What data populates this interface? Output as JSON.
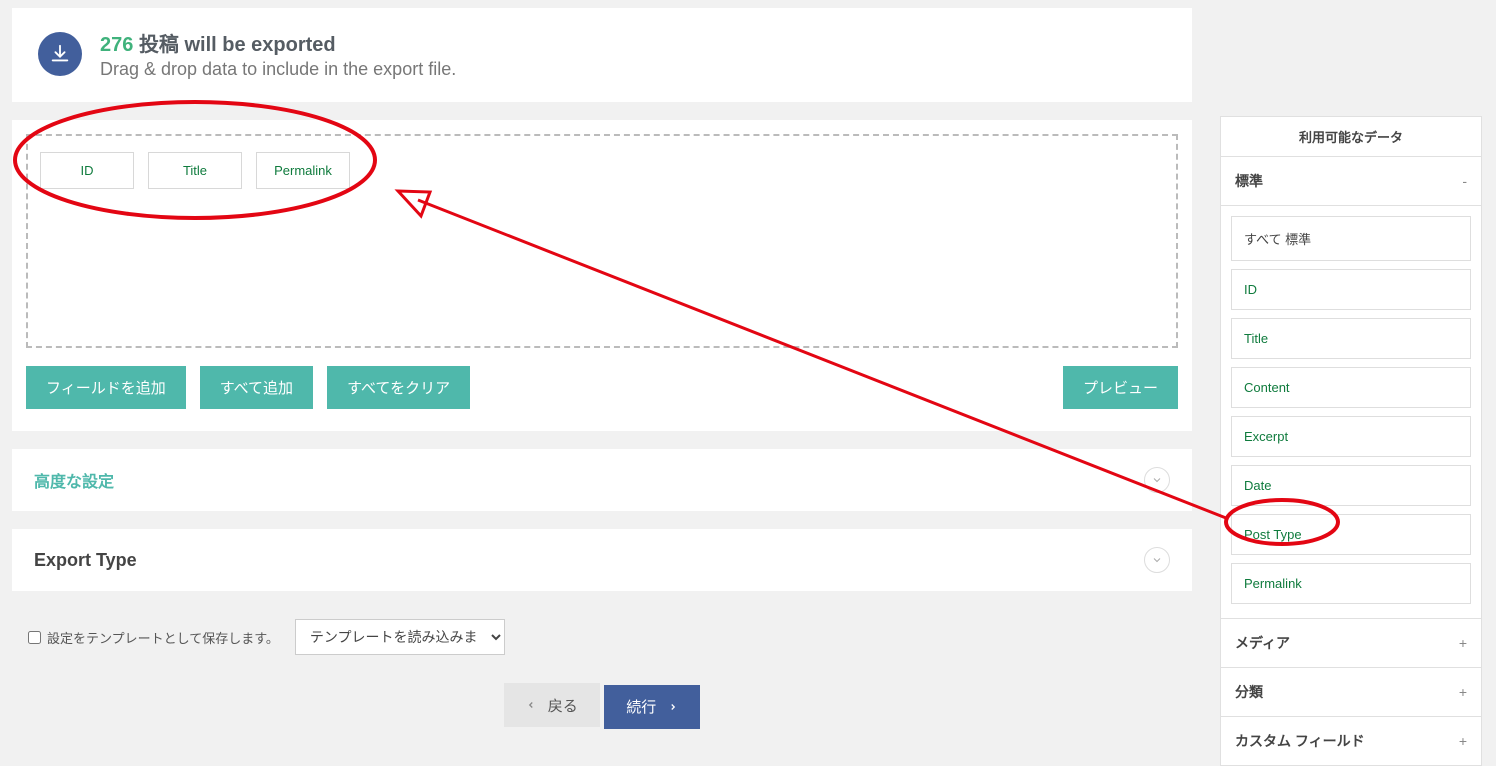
{
  "header": {
    "count": "276",
    "posts_text": "投稿",
    "will_be_exported": "will be exported",
    "subtext": "Drag & drop data to include in the export file."
  },
  "drop_zone": {
    "fields": [
      "ID",
      "Title",
      "Permalink"
    ]
  },
  "buttons": {
    "add_field": "フィールドを追加",
    "add_all": "すべて追加",
    "clear_all": "すべてをクリア",
    "preview": "プレビュー"
  },
  "accordions": {
    "advanced": "高度な設定",
    "export_type": "Export Type"
  },
  "save_row": {
    "checkbox_label": "設定をテンプレートとして保存します。",
    "select_placeholder": "テンプレートを読み込みます..."
  },
  "nav": {
    "back": "戻る",
    "continue": "続行"
  },
  "sidebar": {
    "title": "利用可能なデータ",
    "groups": {
      "standard": {
        "label": "標準",
        "all_label": "すべて 標準",
        "items": [
          "ID",
          "Title",
          "Content",
          "Excerpt",
          "Date",
          "Post Type",
          "Permalink"
        ]
      },
      "media": {
        "label": "メディア"
      },
      "taxonomy": {
        "label": "分類"
      },
      "custom_fields": {
        "label": "カスタム フィールド"
      }
    }
  }
}
